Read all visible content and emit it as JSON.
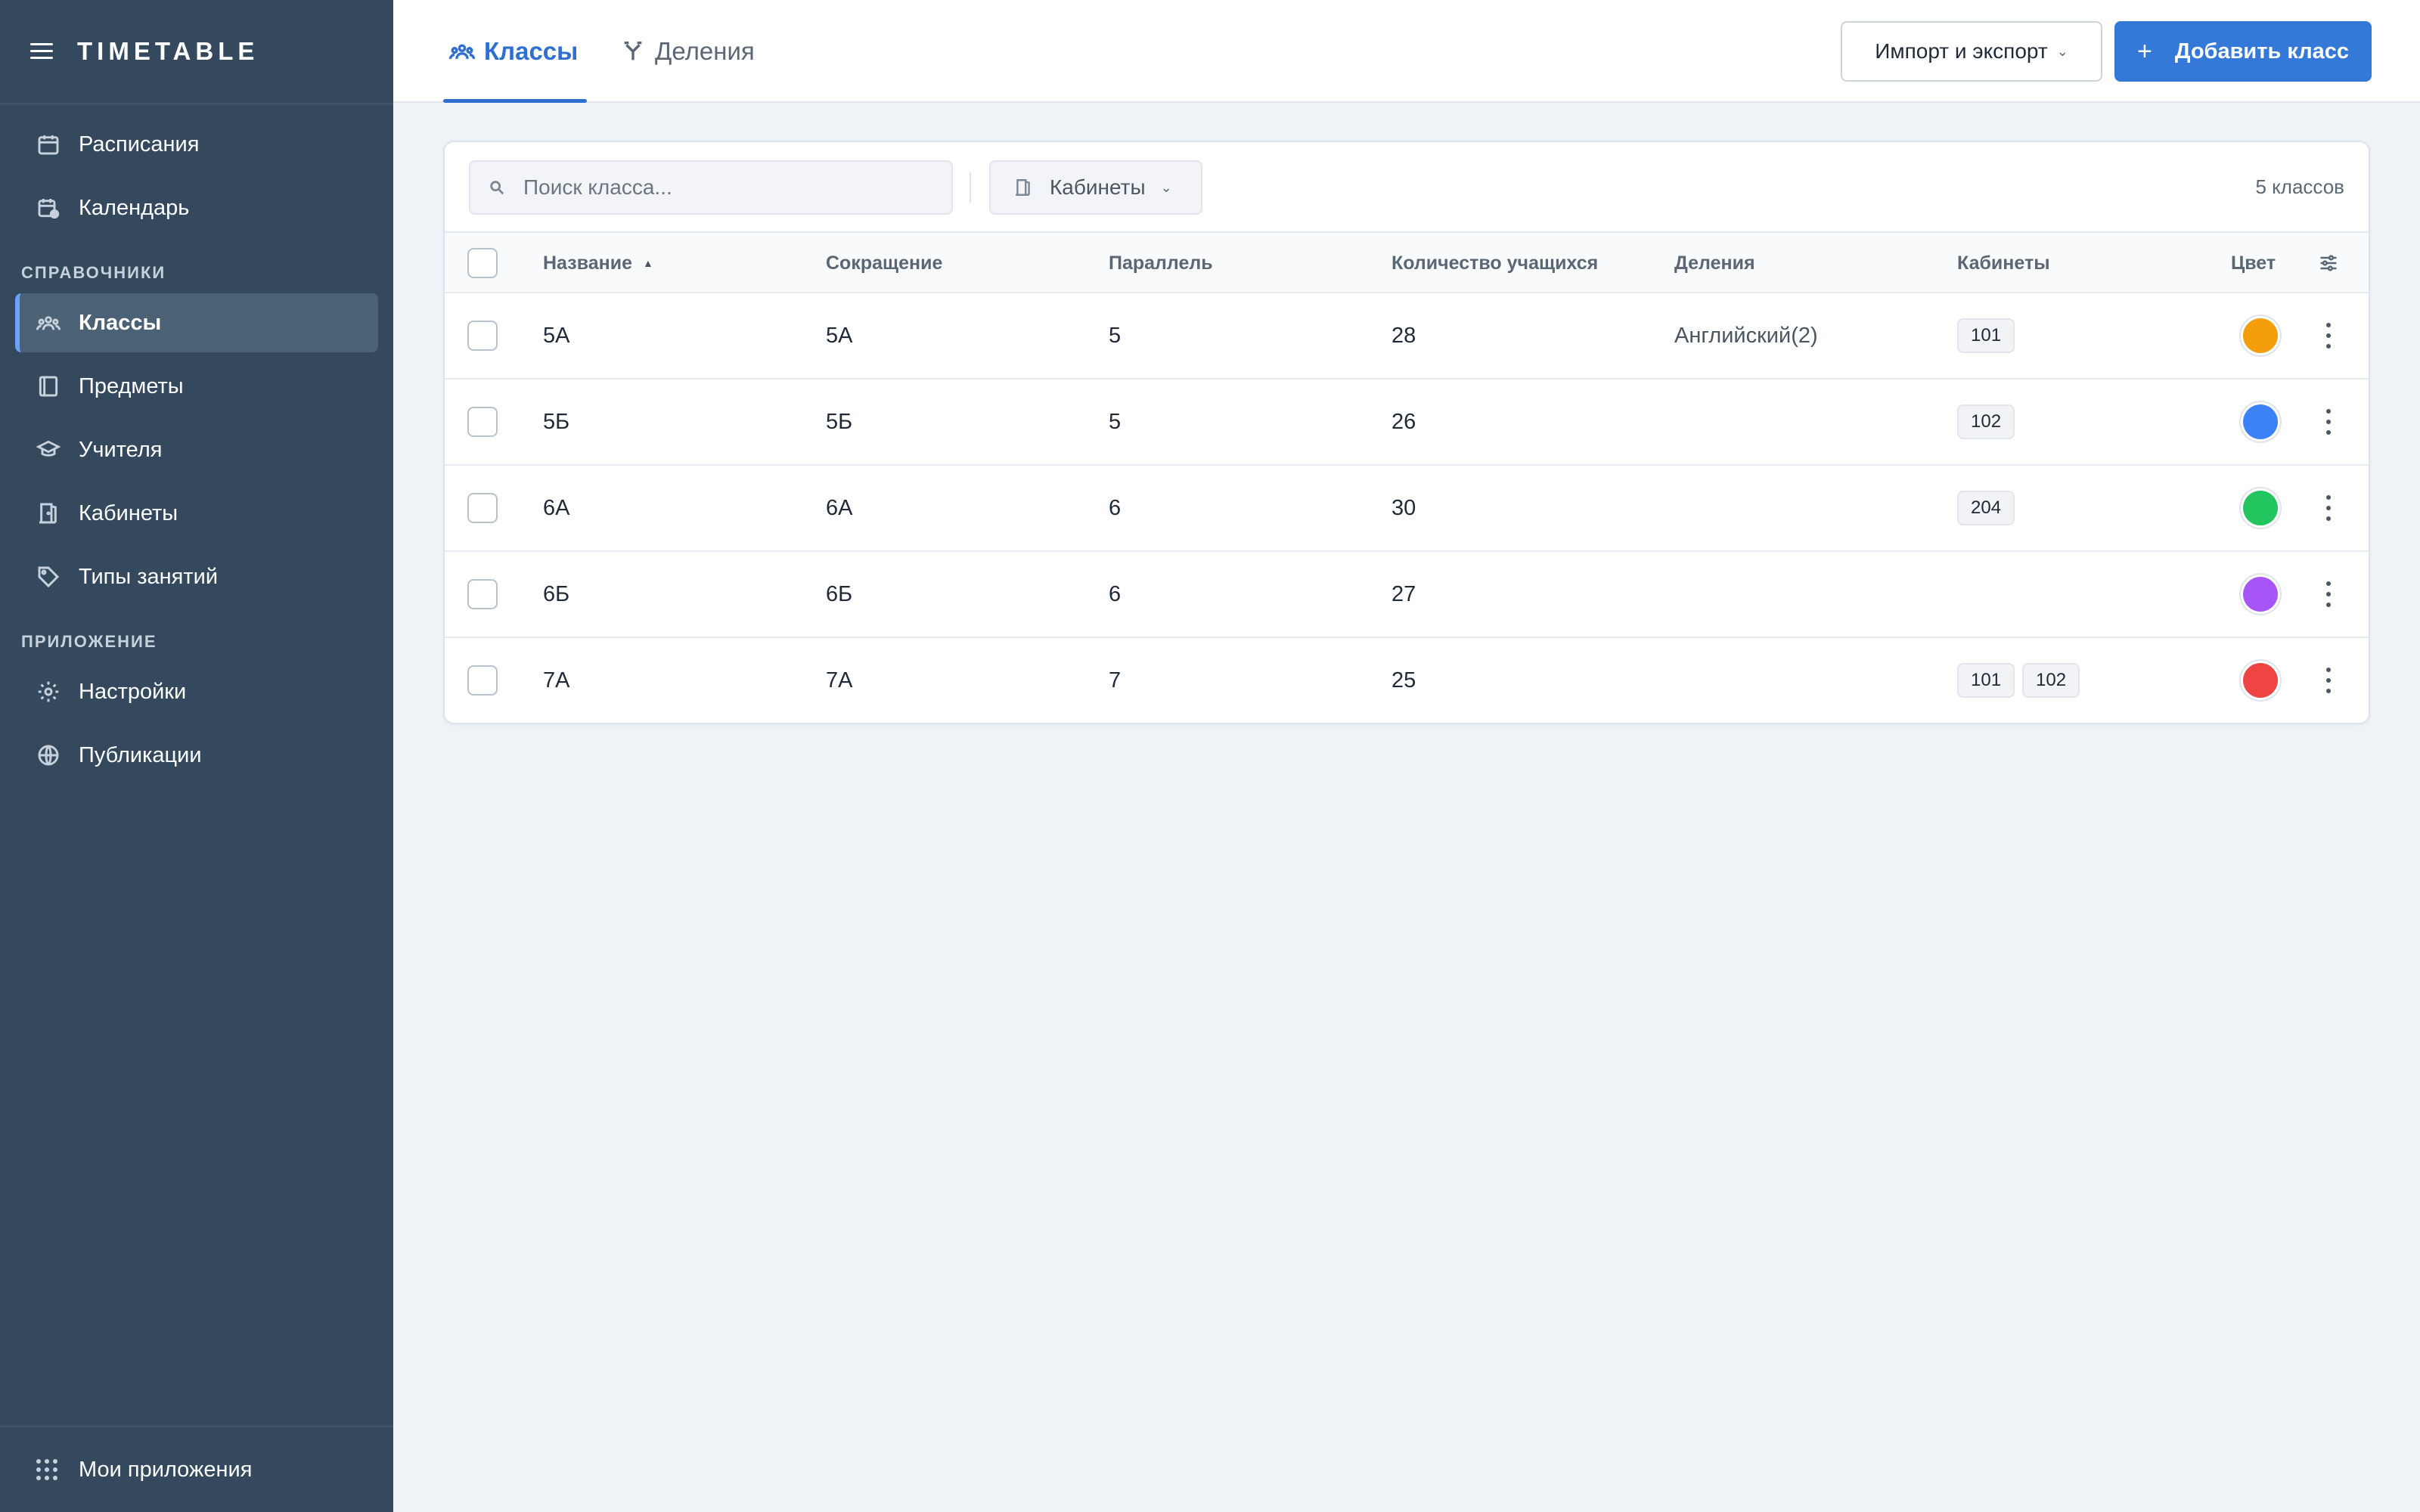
{
  "app": {
    "brand": "TIMETABLE"
  },
  "sidebar": {
    "top_items": [
      {
        "label": "Расписания",
        "icon": "calendar-icon"
      },
      {
        "label": "Календарь",
        "icon": "calendar-clock-icon"
      }
    ],
    "section_reference": "СПРАВОЧНИКИ",
    "reference_items": [
      {
        "label": "Классы",
        "icon": "users-icon",
        "active": true
      },
      {
        "label": "Предметы",
        "icon": "book-icon"
      },
      {
        "label": "Учителя",
        "icon": "graduation-cap-icon"
      },
      {
        "label": "Кабинеты",
        "icon": "door-icon"
      },
      {
        "label": "Типы занятий",
        "icon": "tag-icon"
      }
    ],
    "section_app": "ПРИЛОЖЕНИЕ",
    "app_items": [
      {
        "label": "Настройки",
        "icon": "gear-icon"
      },
      {
        "label": "Публикации",
        "icon": "globe-icon"
      }
    ],
    "bottom_label": "Мои приложения"
  },
  "header": {
    "tabs": [
      {
        "label": "Классы",
        "active": true
      },
      {
        "label": "Деления",
        "active": false
      }
    ],
    "import_export_label": "Импорт и экспорт",
    "add_label": "Добавить класс"
  },
  "toolbar": {
    "search_placeholder": "Поиск класса...",
    "filter_label": "Кабинеты",
    "count_label": "5 классов"
  },
  "table": {
    "columns": {
      "name": "Название",
      "abbr": "Сокращение",
      "parallel": "Параллель",
      "students": "Количество учащихся",
      "divisions": "Деления",
      "rooms": "Кабинеты",
      "color": "Цвет"
    },
    "sort": {
      "column": "name",
      "direction": "asc"
    },
    "rows": [
      {
        "name": "5А",
        "abbr": "5А",
        "parallel": "5",
        "students": "28",
        "division": "Английский(2)",
        "rooms": [
          "101"
        ],
        "color": "#f59e0b"
      },
      {
        "name": "5Б",
        "abbr": "5Б",
        "parallel": "5",
        "students": "26",
        "division": "",
        "rooms": [
          "102"
        ],
        "color": "#3b82f6"
      },
      {
        "name": "6А",
        "abbr": "6А",
        "parallel": "6",
        "students": "30",
        "division": "",
        "rooms": [
          "204"
        ],
        "color": "#22c55e"
      },
      {
        "name": "6Б",
        "abbr": "6Б",
        "parallel": "6",
        "students": "27",
        "division": "",
        "rooms": [],
        "color": "#a855f7"
      },
      {
        "name": "7А",
        "abbr": "7А",
        "parallel": "7",
        "students": "25",
        "division": "",
        "rooms": [
          "101",
          "102"
        ],
        "color": "#ef4444"
      }
    ]
  },
  "colors": {
    "sidebar_bg": "#34495e",
    "accent": "#3579d8",
    "page_bg": "#eff3f8"
  }
}
